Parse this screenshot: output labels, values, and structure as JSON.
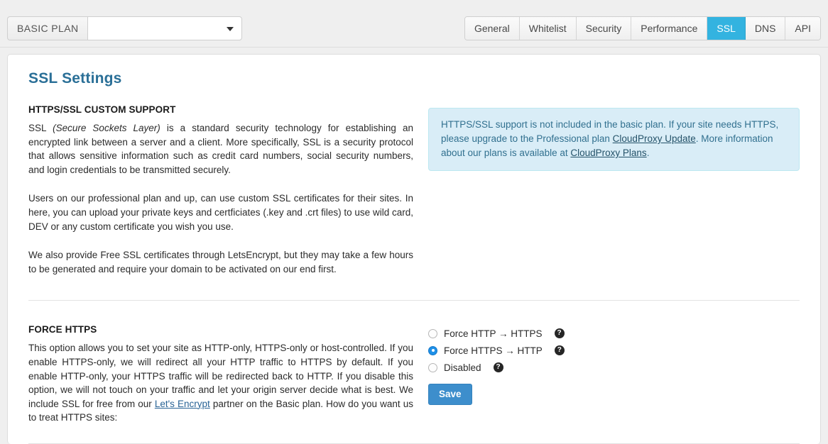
{
  "header": {
    "plan_label": "BASIC PLAN",
    "site_select_value": "",
    "site_select_placeholder": "",
    "caret_icon": "chevron-down-icon"
  },
  "tabs": [
    {
      "label": "General",
      "active": false
    },
    {
      "label": "Whitelist",
      "active": false
    },
    {
      "label": "Security",
      "active": false
    },
    {
      "label": "Performance",
      "active": false
    },
    {
      "label": "SSL",
      "active": true
    },
    {
      "label": "DNS",
      "active": false
    },
    {
      "label": "API",
      "active": false
    }
  ],
  "page": {
    "title": "SSL Settings"
  },
  "custom_support": {
    "section_title": "HTTPS/SSL CUSTOM SUPPORT",
    "p1_a": "SSL ",
    "p1_em": "(Secure Sockets Layer)",
    "p1_b": " is a standard security technology for establishing an encrypted link between a server and a client. More specifically, SSL is a security protocol that allows sensitive information such as credit card numbers, social security numbers, and login credentials to be transmitted securely.",
    "p2": "Users on our professional plan and up, can use custom SSL certificates for their sites. In here, you can upload your private keys and certficiates (.key and .crt files) to use wild card, DEV or any custom certificate you wish you use.",
    "p3": "We also provide Free SSL certificates through LetsEncrypt, but they may take a few hours to be generated and require your domain to be activated on our end first."
  },
  "alert": {
    "text_a": "HTTPS/SSL support is not included in the basic plan. If your site needs HTTPS, please upgrade to the Professional plan ",
    "link1": "CloudProxy Update",
    "text_b": ". More information about our plans is available at ",
    "link2": "CloudProxy Plans",
    "text_c": "."
  },
  "force_https": {
    "section_title": "FORCE HTTPS",
    "text_a": "This option allows you to set your site as HTTP-only, HTTPS-only or host-controlled. If you enable HTTPS-only, we will redirect all your HTTP traffic to HTTPS by default. If you enable HTTP-only, your HTTPS traffic will be redirected back to HTTP. If you disable this option, we will not touch on your traffic and let your origin server decide what is best. We include SSL for free from our ",
    "link": "Let's Encrypt",
    "text_b": " partner on the Basic plan. How do you want us to treat HTTPS sites:",
    "options": [
      {
        "label": "Force HTTP → HTTPS",
        "checked": false,
        "help_icon": "help-circle-icon"
      },
      {
        "label": "Force HTTPS → HTTP",
        "checked": true,
        "help_icon": "help-circle-icon"
      },
      {
        "label": "Disabled",
        "checked": false,
        "help_icon": "help-circle-icon"
      }
    ],
    "save_label": "Save"
  },
  "colors": {
    "page_bg": "#efefef",
    "accent_tab_active": "#33b3e0",
    "title_blue": "#2a6f97",
    "link_blue": "#2a6496",
    "alert_bg": "#d9edf7",
    "alert_border": "#bce8f1",
    "alert_text": "#31708f",
    "radio_checked": "#1e90e8",
    "save_button": "#3d8ecc",
    "help_icon": "#262626"
  }
}
